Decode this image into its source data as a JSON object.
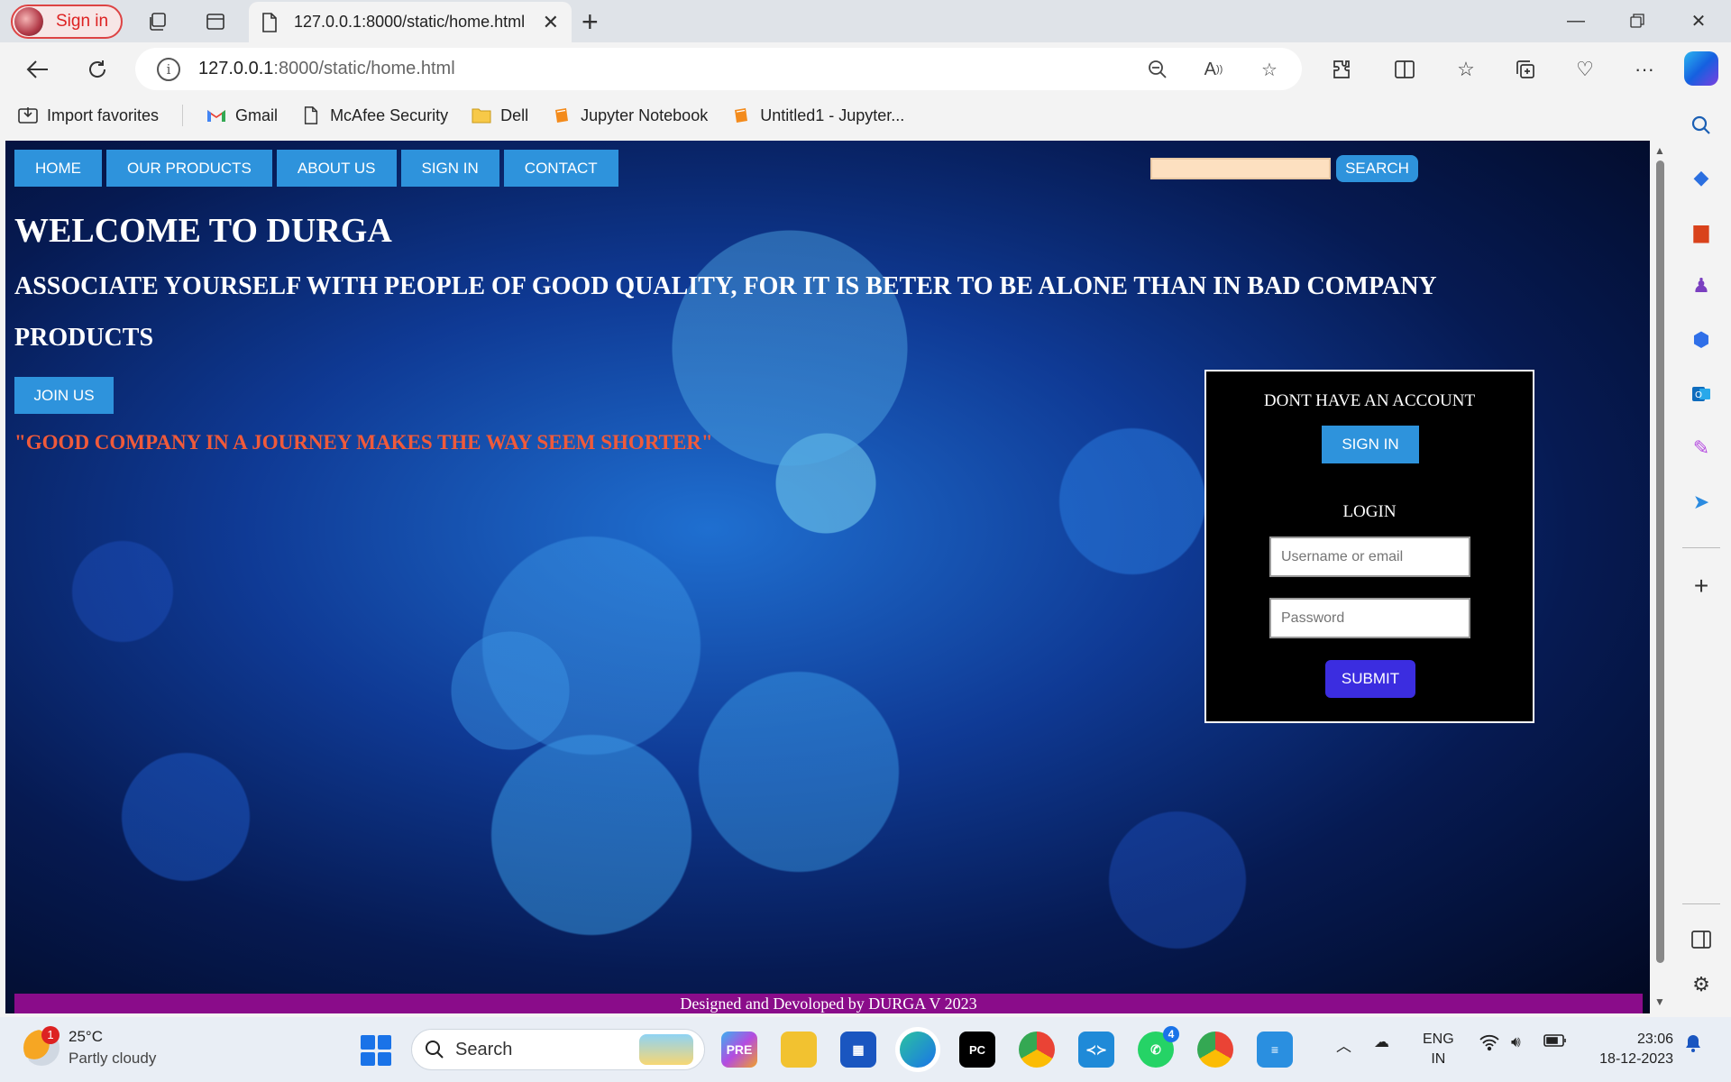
{
  "browser": {
    "profile_label": "Sign in",
    "tab_title": "127.0.0.1:8000/static/home.html",
    "url_host": "127.0.0.1",
    "url_path": ":8000/static/home.html",
    "bookmarks": [
      {
        "label": "Import favorites",
        "icon": "import-icon"
      },
      {
        "label": "Gmail",
        "icon": "gmail-icon"
      },
      {
        "label": "McAfee Security",
        "icon": "page-icon"
      },
      {
        "label": "Dell",
        "icon": "folder-icon"
      },
      {
        "label": "Jupyter Notebook",
        "icon": "jupyter-icon"
      },
      {
        "label": "Untitled1 - Jupyter...",
        "icon": "jupyter-icon"
      }
    ]
  },
  "page": {
    "nav": [
      "HOME",
      "OUR PRODUCTS",
      "ABOUT US",
      "SIGN IN",
      "CONTACT"
    ],
    "search_button": "SEARCH",
    "search_value": "",
    "welcome": "WELCOME TO DURGA",
    "quote_main": "ASSOCIATE YOURSELF WITH PEOPLE OF GOOD QUALITY, FOR IT IS BETER TO BE ALONE THAN IN BAD COMPANY",
    "products_heading": "PRODUCTS",
    "join_button": "JOIN US",
    "quote_secondary": "\"GOOD COMPANY IN A JOURNEY MAKES THE WAY SEEM SHORTER\"",
    "login_panel": {
      "no_account_text": "DONT HAVE AN ACCOUNT",
      "signin_button": "SIGN IN",
      "login_heading": "LOGIN",
      "username_placeholder": "Username or email",
      "password_placeholder": "Password",
      "submit_button": "SUBMIT"
    },
    "footer": "Designed and Devoloped by DURGA V 2023"
  },
  "taskbar": {
    "weather_temp": "25°C",
    "weather_desc": "Partly cloudy",
    "weather_badge": "1",
    "search_placeholder": "Search",
    "whatsapp_badge": "4",
    "lang_line1": "ENG",
    "lang_line2": "IN",
    "time": "23:06",
    "date": "18-12-2023"
  },
  "colors": {
    "nav_button": "#2e93dc",
    "submit_button": "#3b2de0",
    "footer_bar": "#8a0c8a",
    "quote_secondary": "#f05a3a",
    "search_input_bg": "#fde0c0"
  }
}
